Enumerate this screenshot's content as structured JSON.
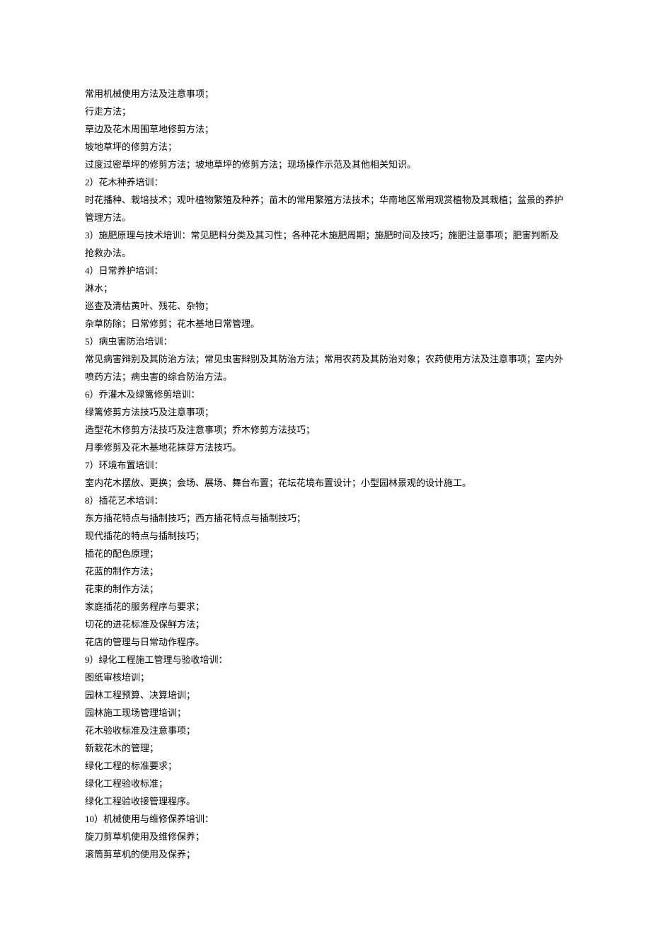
{
  "lines": [
    "常用机械使用方法及注意事项；",
    "行走方法；",
    "草边及花木周围草地修剪方法；",
    "坡地草坪的修剪方法；",
    "过度过密草坪的修剪方法；坡地草坪的修剪方法；现场操作示范及其他相关知识。",
    "2）花木种养培训：",
    "时花播种、栽培技术；观叶植物繁殖及种养；苗木的常用繁殖方法技术；华南地区常用观赏植物及其栽植；盆景的养护管理方法。",
    "3）施肥原理与技术培训：常见肥料分类及其习性；各种花木施肥周期；施肥时间及技巧；施肥注意事项；肥害判断及抢救办法。",
    "4）日常养护培训：",
    "淋水；",
    "巡查及清枯黄叶、残花、杂物；",
    "杂草防除；日常修剪；花木基地日常管理。",
    "5）病虫害防治培训：",
    "常见病害辩别及其防治方法；常见虫害辩别及其防治方法；常用农药及其防治对象；农药使用方法及注意事项；室内外喷药方法；病虫害的综合防治方法。",
    "6）乔灌木及绿篱修剪培训：",
    "绿篱修剪方法技巧及注意事项；",
    "造型花木修剪方法技巧及注意事项；乔木修剪方法技巧；",
    "月季修剪及花木基地花抹芽方法技巧。",
    "7）环境布置培训：",
    "室内花木摆放、更换；会场、展场、舞台布置；花坛花境布置设计；小型园林景观的设计施工。",
    "8）插花艺术培训：",
    "东方插花特点与插制技巧；西方插花特点与插制技巧；",
    "现代插花的特点与插制技巧；",
    "插花的配色原理；",
    "花蓝的制作方法；",
    "花束的制作方法；",
    "家庭插花的服务程序与要求；",
    "切花的进花标准及保鲜方法；",
    "花店的管理与日常动作程序。",
    "9）绿化工程施工管理与验收培训：",
    "图纸审核培训；",
    "园林工程预算、决算培训；",
    "园林施工现场管理培训；",
    "花木验收标准及注意事项；",
    "新栽花木的管理；",
    "绿化工程的标准要求；",
    "绿化工程验收标准；",
    "绿化工程验收接管理程序。",
    "10）机械使用与维修保养培训：",
    "旋刀剪草机使用及维修保养；",
    "滚筒剪草机的使用及保养；"
  ]
}
